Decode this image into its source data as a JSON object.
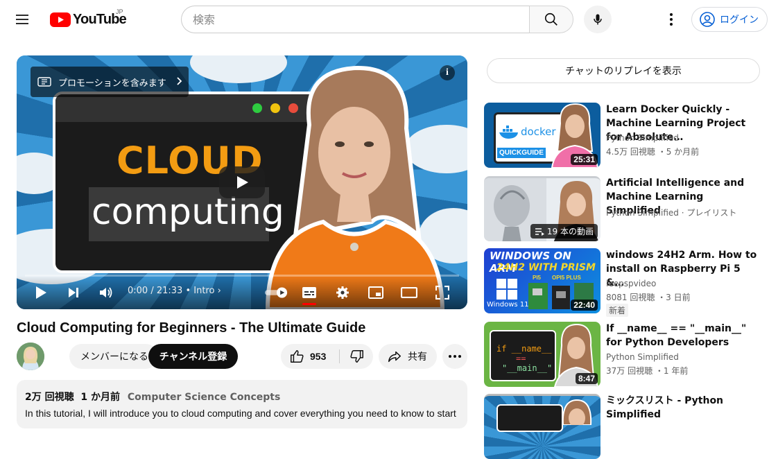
{
  "header": {
    "logo_text": "YouTube",
    "region": "JP",
    "search_placeholder": "検索",
    "login_label": "ログイン"
  },
  "player": {
    "promo_label": "プロモーションを含みます",
    "thumb_word1": "CLOUD",
    "thumb_word2": "computing",
    "time": "0:00 / 21:33",
    "chapter": "• Intro",
    "progress_fraction": 0.0
  },
  "video": {
    "title": "Cloud Computing for Beginners - The Ultimate Guide",
    "join_label": "メンバーになる",
    "subscribe_label": "チャンネル登録",
    "likes": "953",
    "share_label": "共有"
  },
  "description": {
    "views": "2万 回視聴",
    "age": "1 か月前",
    "tag": "Computer Science Concepts",
    "text": "In this tutorial, I will introduce you to cloud computing and cover everything you need to know to start"
  },
  "sidebar": {
    "chat_replay_label": "チャットのリプレイを表示",
    "items": [
      {
        "title": "Learn Docker Quickly - Machine Learning Project for Absolute…",
        "channel": "Python Simplified",
        "meta": "4.5万 回視聴 ・5 か月前",
        "duration": "25:31",
        "thumb_text1": "docker",
        "thumb_text2": "QUICKGUIDE"
      },
      {
        "title": "Artificial Intelligence and Machine Learning Simplified",
        "channel": "Python Simplified · プレイリスト",
        "playlist_count": "19 本の動画"
      },
      {
        "title": "windows 24H2 Arm. How to install on Raspberry Pi 5 &…",
        "channel": "leepspvideo",
        "meta": "8081 回視聴 ・3 日前",
        "duration": "22:40",
        "badge": "新着",
        "thumb_text1": "WINDOWS ON ARM",
        "thumb_text2": "24H2 WITH PRISM",
        "thumb_text3": "Windows 11",
        "thumb_text4": "PI5",
        "thumb_text5": "OPI5 PLUS"
      },
      {
        "title": "If __name__ == \"__main__\" for Python Developers",
        "channel": "Python Simplified",
        "meta": "37万 回視聴 ・1 年前",
        "duration": "8:47",
        "code1": "if __name__",
        "code2": "==",
        "code3": "\"__main__\""
      },
      {
        "title": "ミックスリスト - Python Simplified"
      }
    ]
  },
  "colors": {
    "brand_red": "#ff0000",
    "accent_orange": "#f39c12",
    "link_blue": "#065fd4"
  }
}
